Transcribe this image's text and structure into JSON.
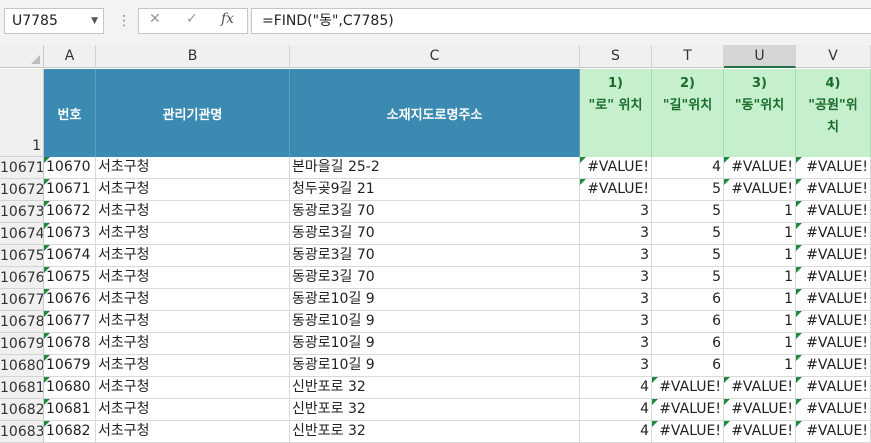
{
  "name_box": "U7785",
  "formula_buttons": {
    "cancel": "✕",
    "enter": "✓",
    "fx": "fx"
  },
  "formula": "=FIND(\"동\",C7785)",
  "columns": [
    "A",
    "B",
    "C",
    "S",
    "T",
    "U",
    "V"
  ],
  "selected_column": "U",
  "header_row_number": "1",
  "headers": {
    "A": "번호",
    "B": "관리기관명",
    "C": "소재지도로명주소",
    "S": [
      "1)",
      "\"로\" 위치"
    ],
    "T": [
      "2)",
      "\"길\"위치"
    ],
    "U": [
      "3)",
      "\"동\"위치"
    ],
    "V": [
      "4)",
      "\"공원\"위",
      "치"
    ]
  },
  "rows": [
    {
      "row": "10671",
      "A": "10670",
      "B": "서초구청",
      "C": "본마을길 25-2",
      "S": "#VALUE!",
      "T": "4",
      "U": "#VALUE!",
      "V": "#VALUE!"
    },
    {
      "row": "10672",
      "A": "10671",
      "B": "서초구청",
      "C": "청두곶9길 21",
      "S": "#VALUE!",
      "T": "5",
      "U": "#VALUE!",
      "V": "#VALUE!"
    },
    {
      "row": "10673",
      "A": "10672",
      "B": "서초구청",
      "C": "동광로3길 70",
      "S": "3",
      "T": "5",
      "U": "1",
      "V": "#VALUE!"
    },
    {
      "row": "10674",
      "A": "10673",
      "B": "서초구청",
      "C": "동광로3길 70",
      "S": "3",
      "T": "5",
      "U": "1",
      "V": "#VALUE!"
    },
    {
      "row": "10675",
      "A": "10674",
      "B": "서초구청",
      "C": "동광로3길 70",
      "S": "3",
      "T": "5",
      "U": "1",
      "V": "#VALUE!"
    },
    {
      "row": "10676",
      "A": "10675",
      "B": "서초구청",
      "C": "동광로3길 70",
      "S": "3",
      "T": "5",
      "U": "1",
      "V": "#VALUE!"
    },
    {
      "row": "10677",
      "A": "10676",
      "B": "서초구청",
      "C": "동광로10길 9",
      "S": "3",
      "T": "6",
      "U": "1",
      "V": "#VALUE!"
    },
    {
      "row": "10678",
      "A": "10677",
      "B": "서초구청",
      "C": "동광로10길 9",
      "S": "3",
      "T": "6",
      "U": "1",
      "V": "#VALUE!"
    },
    {
      "row": "10679",
      "A": "10678",
      "B": "서초구청",
      "C": "동광로10길 9",
      "S": "3",
      "T": "6",
      "U": "1",
      "V": "#VALUE!"
    },
    {
      "row": "10680",
      "A": "10679",
      "B": "서초구청",
      "C": "동광로10길 9",
      "S": "3",
      "T": "6",
      "U": "1",
      "V": "#VALUE!"
    },
    {
      "row": "10681",
      "A": "10680",
      "B": "서초구청",
      "C": "신반포로 32",
      "S": "4",
      "T": "#VALUE!",
      "U": "#VALUE!",
      "V": "#VALUE!"
    },
    {
      "row": "10682",
      "A": "10681",
      "B": "서초구청",
      "C": "신반포로 32",
      "S": "4",
      "T": "#VALUE!",
      "U": "#VALUE!",
      "V": "#VALUE!"
    },
    {
      "row": "10683",
      "A": "10682",
      "B": "서초구청",
      "C": "신반포로 32",
      "S": "4",
      "T": "#VALUE!",
      "U": "#VALUE!",
      "V": "#VALUE!"
    }
  ]
}
